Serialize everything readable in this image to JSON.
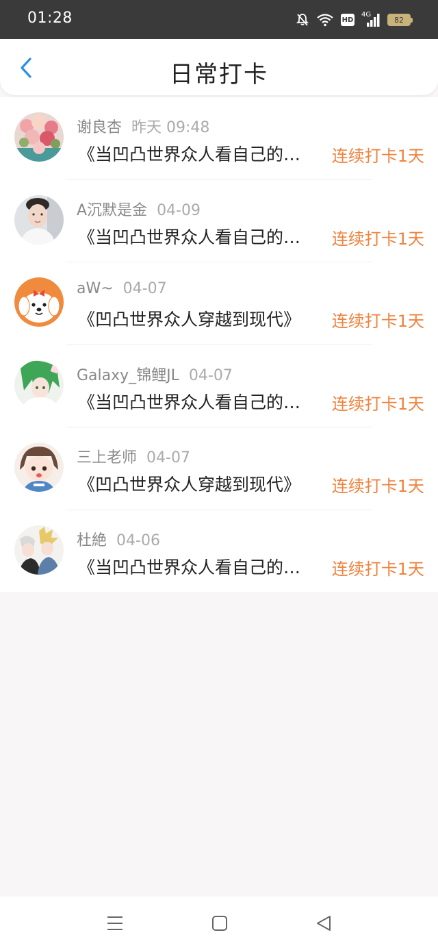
{
  "status_bar": {
    "time": "01:28",
    "icons": [
      "bell-muted-icon",
      "wifi-icon",
      "hd-icon",
      "signal-4g-icon",
      "battery-icon"
    ],
    "hd_label": "HD",
    "network_label": "4G",
    "battery_level": "82"
  },
  "header": {
    "back_icon": "chevron-left-icon",
    "title": "日常打卡",
    "accent_color": "#2b8fe3"
  },
  "colors": {
    "streak": "#f0823c",
    "name": "#888888",
    "title": "#222222"
  },
  "checkins": [
    {
      "name": "谢良杏",
      "date": "昨天 09:48",
      "book": "《当凹凸世界众人看自己的…",
      "streak": "连续打卡1天",
      "avatar": "flower-bouquet-avatar"
    },
    {
      "name": "A⁣⁣沉默是金",
      "date": "04-09",
      "book": "《当凹凸世界众人看自己的…",
      "streak": "连续打卡1天",
      "avatar": "boy-portrait-avatar"
    },
    {
      "name": "aW~",
      "date": "04-07",
      "book": "《凹凸世界众人穿越到现代》",
      "streak": "连续打卡1天",
      "avatar": "puppy-cartoon-avatar"
    },
    {
      "name": "Galaxy_锦鲤JL",
      "date": "04-07",
      "book": "《当凹凸世界众人看自己的…",
      "streak": "连续打卡1天",
      "avatar": "green-hair-anime-avatar"
    },
    {
      "name": "三上老师",
      "date": "04-07",
      "book": "《凹凸世界众人穿越到现代》",
      "streak": "连续打卡1天",
      "avatar": "anime-girl-avatar"
    },
    {
      "name": "杜絶",
      "date": "04-06",
      "book": "《当凹凸世界众人看自己的…",
      "streak": "连续打卡1天",
      "avatar": "anime-duo-avatar"
    }
  ],
  "nav_bar": {
    "icons": [
      "menu-icon",
      "home-square-icon",
      "back-triangle-icon"
    ]
  }
}
